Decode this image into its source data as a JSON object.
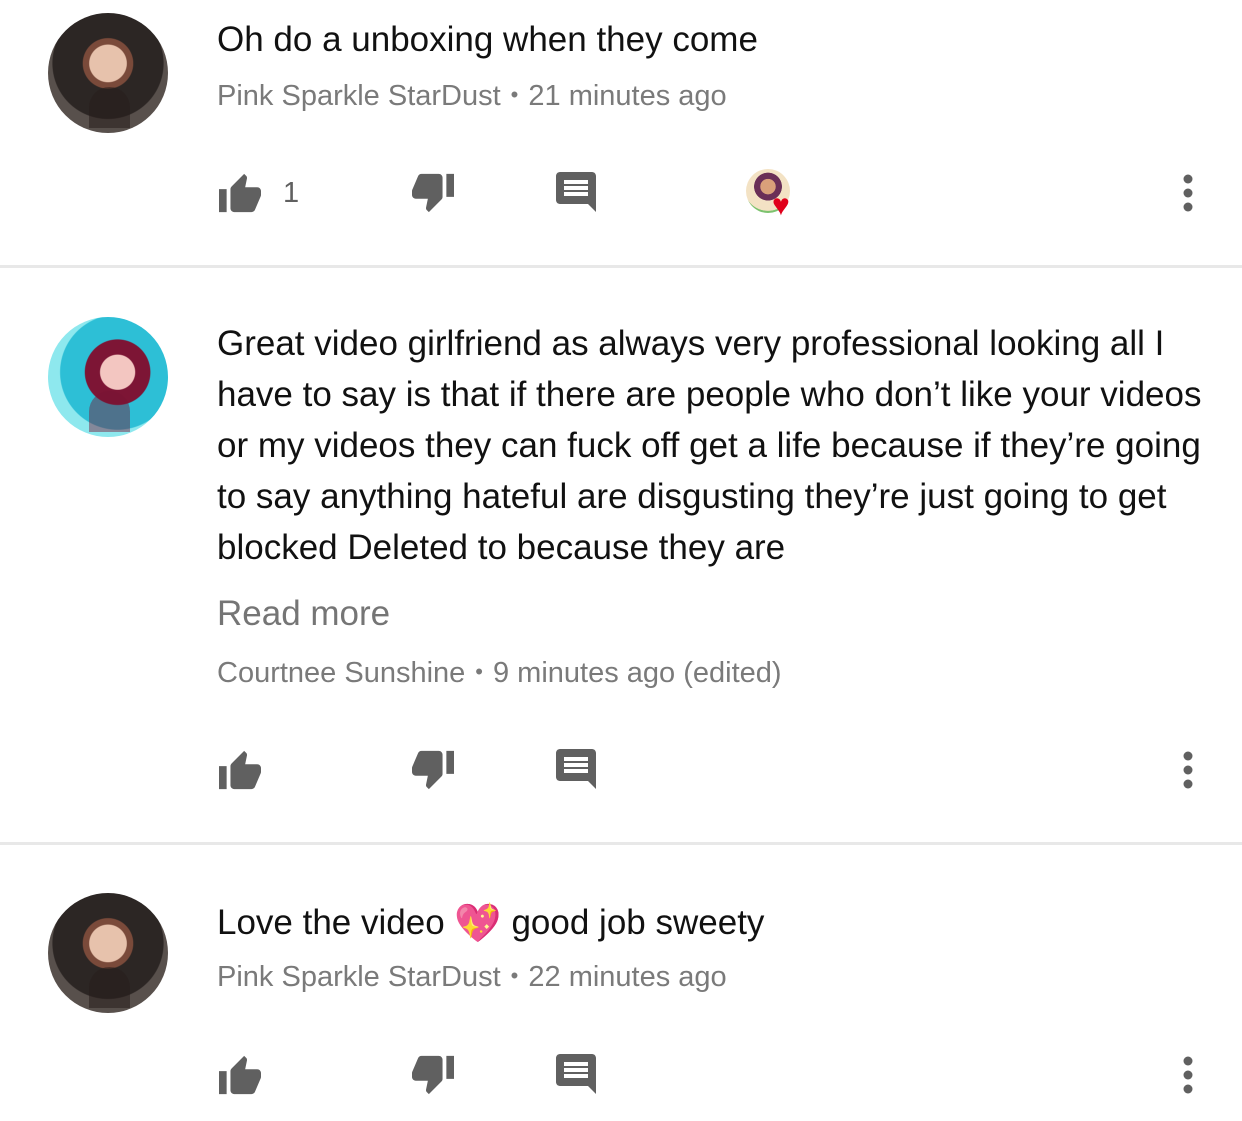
{
  "comments": [
    {
      "text": "Oh do a unboxing when they come",
      "author": "Pink Sparkle StarDust",
      "time": "21 minutes ago",
      "like_count": "1",
      "has_creator_heart": true
    },
    {
      "text": "Great video girlfriend as always very professional looking all I have to say is that if there are people who don’t like your videos or my videos they can fuck off get a life because if they’re going to say anything hateful are disgusting they’re just going to get blocked Deleted to because they are",
      "read_more": "Read more",
      "author": "Courtnee Sunshine",
      "time": "9 minutes ago (edited)"
    },
    {
      "text_before": "Love the video",
      "emoji": "💖",
      "text_after": "good job sweety",
      "author": "Pink Sparkle StarDust",
      "time": "22 minutes ago"
    }
  ],
  "separator": "•",
  "icons": {
    "like": "thumb-up-icon",
    "dislike": "thumb-down-icon",
    "reply": "comment-icon",
    "more": "more-vert-icon",
    "heart": "creator-heart-icon"
  },
  "colors": {
    "text": "#111111",
    "meta": "#7a7a7a",
    "icon": "#606060",
    "heart": "#e0001b",
    "divider": "#e8e8e8"
  }
}
